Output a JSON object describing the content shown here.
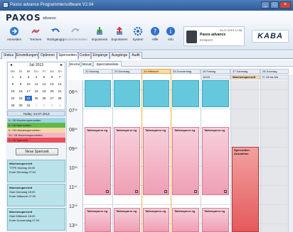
{
  "window": {
    "title": "Paxos advance Programmiersoftware V2.04",
    "controls": [
      "_",
      "□",
      "×"
    ]
  },
  "brand": {
    "name": "PAXOS",
    "sub": "advance"
  },
  "toolbar": [
    {
      "label": "Anmelden",
      "icon": "login-icon",
      "enabled": true
    },
    {
      "label": "Trennen",
      "icon": "disconnect-icon",
      "enabled": true
    },
    {
      "label": "Rückgängig",
      "icon": "undo-icon",
      "enabled": true
    },
    {
      "label": "Wiederherstellen",
      "icon": "redo-icon",
      "enabled": false
    },
    {
      "label": "Importieren",
      "icon": "import-icon",
      "enabled": true
    },
    {
      "label": "Exportieren",
      "icon": "export-icon",
      "enabled": true
    },
    {
      "label": "System",
      "icon": "gear-icon",
      "enabled": true
    },
    {
      "label": "Hilfe",
      "icon": "help-icon",
      "enabled": true
    },
    {
      "label": "Info",
      "icon": "info-icon",
      "enabled": true
    }
  ],
  "lock": {
    "name": "Paxos advance",
    "status": "Entsperrt",
    "datetime": "24.07.2013 17:58"
  },
  "logo": "KABA",
  "tabs": [
    "Status",
    "Einstellungen",
    "Optionen",
    "Sperrzeiten",
    "Codes",
    "Eingänge",
    "Ausgänge",
    "Audit"
  ],
  "active_tab": "Sperrzeiten",
  "mini_calendar": {
    "month": "Juli 2013",
    "weekdays": [
      "Mo",
      "Di",
      "Mi",
      "Do",
      "Fr",
      "Sa",
      "So"
    ],
    "weeks": [
      [
        "1",
        "2",
        "3",
        "4",
        "5",
        "6",
        "7"
      ],
      [
        "8",
        "9",
        "10",
        "11",
        "12",
        "13",
        "14"
      ],
      [
        "15",
        "16",
        "17",
        "18",
        "19",
        "20",
        "21"
      ],
      [
        "22",
        "23",
        "24",
        "25",
        "26",
        "27",
        "28"
      ],
      [
        "29",
        "30",
        "31",
        "1",
        "2",
        "3",
        "4"
      ]
    ],
    "selected": "24",
    "today_label": "Today: 24.07.2013"
  },
  "legend": [
    {
      "label": "0 / 28 Wochensperrzeiten",
      "color": "#9bd5e4"
    },
    {
      "label": "0 / 28 Sperrzeiten",
      "color": "#63b84a"
    },
    {
      "label": "0 / 28 Urlaubssperrzeiten",
      "color": "#f3d9a9"
    },
    {
      "label": "10 / 28 Wochensperrzeiten",
      "color": "#f5b4c4"
    },
    {
      "label": "1 / 28 Sperrzeit",
      "color": "#e9505a"
    }
  ],
  "new_button": "Neue Sperrzeit",
  "entries": [
    {
      "title": "Wochensperrzeit",
      "line1": "TYPE  Montag 18:00",
      "line2": "Ende  Dienstag 07:00"
    },
    {
      "title": "Wochensperrzeit",
      "line1": "Start  Dienstag 18:00",
      "line2": "Ende  Mittwoch 07:00"
    },
    {
      "title": "Wochensperrzeit",
      "line1": "Start  Mittwoch 18:00",
      "line2": "Ende  Donnerstag 07:00"
    }
  ],
  "view_tabs": [
    "Woche",
    "Monat",
    "Sperrzeitenliste"
  ],
  "days": [
    {
      "header": "22  Montag",
      "sub": ""
    },
    {
      "header": "23  Dienstag",
      "sub": ""
    },
    {
      "header": "24  Mittwoch",
      "sub": ""
    },
    {
      "header": "25  Donnerstag",
      "sub": ""
    },
    {
      "header": "26  Freitag",
      "sub": "18:00"
    },
    {
      "header": "27  Samstag",
      "sub": "Wochensperrzeit"
    },
    {
      "header": "28  Sonntag",
      "sub": "Fr 18 bis Mo"
    }
  ],
  "times": [
    "06",
    "07",
    "08",
    "09",
    "10",
    "11",
    "12",
    "13"
  ],
  "event_label": "Tallensperrz eg",
  "red_event_label": "Sperrzeiten Ausnahme"
}
